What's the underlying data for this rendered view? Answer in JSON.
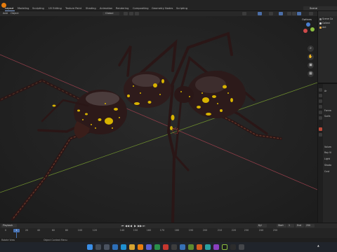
{
  "workspace_tabs": [
    "Layout",
    "Modeling",
    "Sculpting",
    "UV Editing",
    "Texture Paint",
    "Shading",
    "Animation",
    "Rendering",
    "Compositing",
    "Geometry Nodes",
    "Scripting"
  ],
  "scene_name": "Scene",
  "header": {
    "mode_left": "Add",
    "object_menu": "Object",
    "transform_orientation": "Global",
    "options": "Options"
  },
  "outliner": {
    "rows": [
      "Scene Co",
      "Collect",
      "Ant"
    ]
  },
  "properties": {
    "rows": [
      "Ar",
      "Fonna",
      "Surfa",
      "Volum",
      "Ray Vi",
      "Light",
      "Shado",
      "Cust"
    ]
  },
  "timeline": {
    "current_frame": "1",
    "ticks": [
      "0",
      "20",
      "40",
      "60",
      "80",
      "100",
      "120",
      "140",
      "150",
      "160",
      "170",
      "180",
      "190",
      "200",
      "210",
      "220",
      "230",
      "240",
      "250"
    ],
    "start_label": "Start",
    "start_value": "1",
    "end_label": "End",
    "end_value": "250",
    "keying": "Kyl",
    "playback_label": "Playback",
    "controls": [
      "⏮",
      "◀◀",
      "◀",
      "▶",
      "▶▶",
      "⏭"
    ]
  },
  "statusbar": {
    "left": "Rotate View",
    "middle": "Object Context Menu"
  },
  "colors": {
    "accent": "#4772b3",
    "x_axis": "#8e3d48",
    "y_axis": "#6b8a2e",
    "logo": "#e87d0d",
    "ant_body": "#2c1a1a",
    "ant_spots": "#d8b300"
  }
}
